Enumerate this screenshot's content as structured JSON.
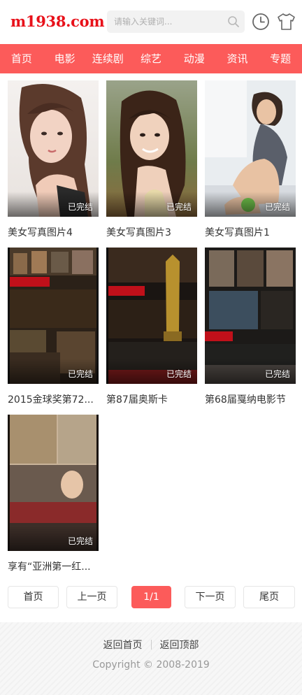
{
  "header": {
    "logo": "m1938.com",
    "search_placeholder": "请输入关键词...",
    "icons": [
      "search-icon",
      "history-icon",
      "shirt-icon"
    ]
  },
  "nav": {
    "items": [
      "首页",
      "电影",
      "连续剧",
      "综艺",
      "动漫",
      "资讯",
      "专题"
    ]
  },
  "colors": {
    "accent": "#fc5b5a",
    "logo": "#e8111a"
  },
  "cards": [
    {
      "title": "美女写真图片4",
      "badge": "已完结"
    },
    {
      "title": "美女写真图片3",
      "badge": "已完结"
    },
    {
      "title": "美女写真图片1",
      "badge": "已完结"
    },
    {
      "title": "2015金球奖第72...",
      "badge": "已完结"
    },
    {
      "title": "第87届奥斯卡",
      "badge": "已完结"
    },
    {
      "title": "第68届戛纳电影节",
      "badge": "已完结"
    },
    {
      "title": "享有“亚洲第一红...",
      "badge": "已完结"
    }
  ],
  "pagination": {
    "first": "首页",
    "prev": "上一页",
    "current": "1/1",
    "next": "下一页",
    "last": "尾页"
  },
  "footer": {
    "home_link": "返回首页",
    "top_link": "返回顶部",
    "copyright": "Copyright © 2008-2019"
  }
}
